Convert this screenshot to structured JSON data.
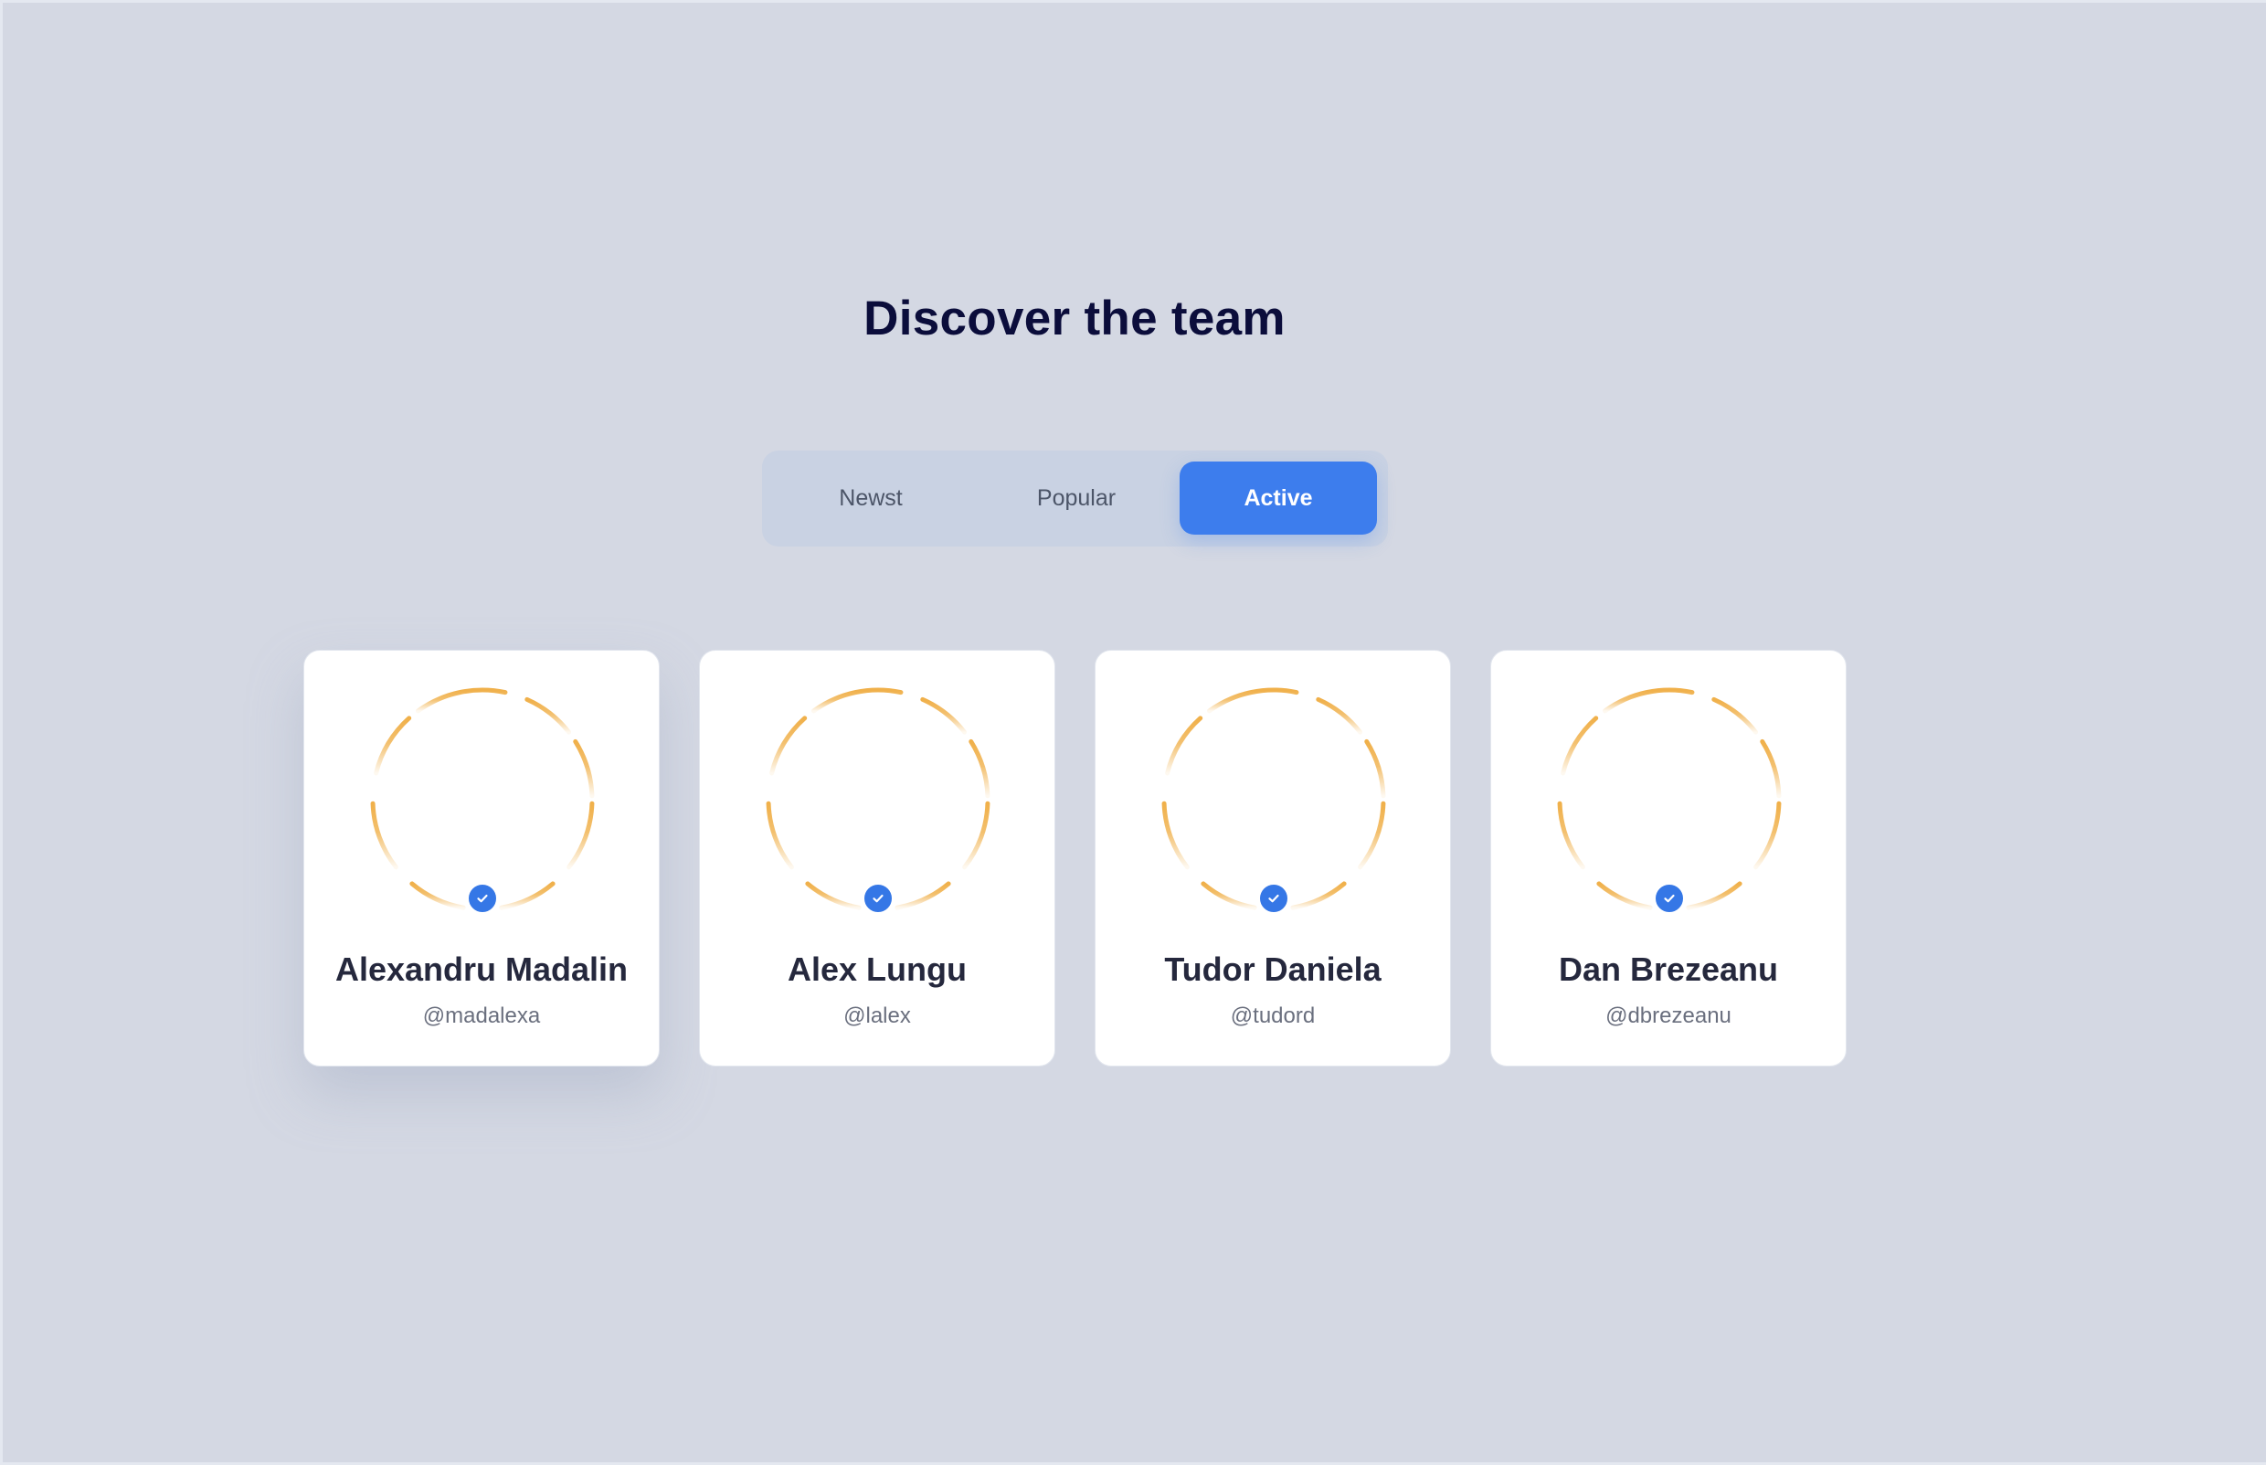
{
  "page": {
    "title": "Discover the team"
  },
  "tabs": [
    {
      "label": "Newst",
      "active": false
    },
    {
      "label": "Popular",
      "active": false
    },
    {
      "label": "Active",
      "active": true
    }
  ],
  "team": [
    {
      "name": "Alexandru Madalin",
      "handle": "@madalexa",
      "verified": true
    },
    {
      "name": "Alex Lungu",
      "handle": "@lalex",
      "verified": true
    },
    {
      "name": "Tudor Daniela",
      "handle": "@tudord",
      "verified": true
    },
    {
      "name": "Dan Brezeanu",
      "handle": "@dbrezeanu",
      "verified": true
    }
  ],
  "icons": {
    "avatar_ring": "avatar-ring-icon",
    "verified": "check-badge-icon"
  },
  "colors": {
    "background": "#d4d8e3",
    "accent": "#3d7ded",
    "ring": "#f0b04a",
    "title": "#0b0d3b"
  }
}
